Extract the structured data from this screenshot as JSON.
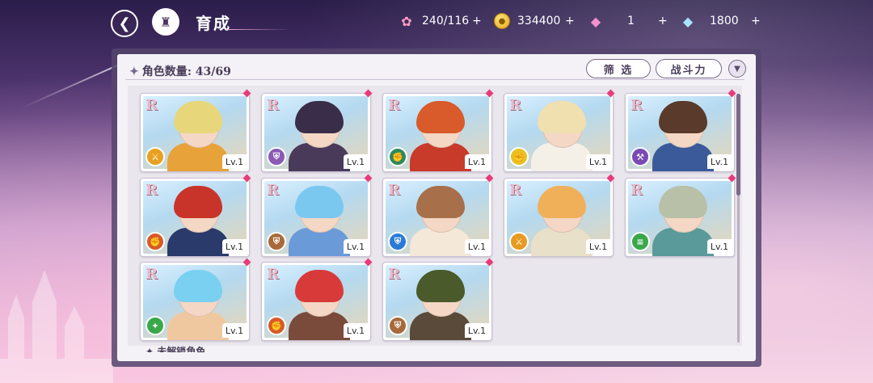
{
  "header": {
    "title": "育成",
    "resources": [
      {
        "icon": "candy-icon",
        "value": "240/116"
      },
      {
        "icon": "coin-icon",
        "value": "334400"
      },
      {
        "icon": "pink-gem-icon",
        "value": "1"
      },
      {
        "icon": "blue-gem-icon",
        "value": "1800"
      }
    ]
  },
  "panel": {
    "count_label": "角色数量: 43/69",
    "filter_label": "筛 选",
    "sort_label": "战斗力",
    "footer_label": "未解锁角色"
  },
  "characters": [
    {
      "rarity": "R",
      "level": "Lv.1",
      "hair": "#e8d77a",
      "outfit": "#e8a23a",
      "role_color": "#e8a020",
      "role_icon": "dagger-icon"
    },
    {
      "rarity": "R",
      "level": "Lv.1",
      "hair": "#3a2d4a",
      "outfit": "#4a3a5a",
      "role_color": "#8a5ab5",
      "role_icon": "shield-icon"
    },
    {
      "rarity": "R",
      "level": "Lv.1",
      "hair": "#d95a2a",
      "outfit": "#c83a2a",
      "role_color": "#2e8a5a",
      "role_icon": "fist-icon"
    },
    {
      "rarity": "R",
      "level": "Lv.1",
      "hair": "#f0e0b0",
      "outfit": "#f4f0e8",
      "role_color": "#e8c020",
      "role_icon": "fist-icon"
    },
    {
      "rarity": "R",
      "level": "Lv.1",
      "hair": "#5a3a2a",
      "outfit": "#3a5a9a",
      "role_color": "#7a4ab5",
      "role_icon": "hammer-icon"
    },
    {
      "rarity": "R",
      "level": "Lv.1",
      "hair": "#c8342a",
      "outfit": "#2a3a6a",
      "role_color": "#d85a2a",
      "role_icon": "fist-icon"
    },
    {
      "rarity": "R",
      "level": "Lv.1",
      "hair": "#7ac8f0",
      "outfit": "#6a9ad8",
      "role_color": "#a86a3a",
      "role_icon": "shield-icon"
    },
    {
      "rarity": "R",
      "level": "Lv.1",
      "hair": "#a8704a",
      "outfit": "#f4e8d8",
      "role_color": "#2a7ad8",
      "role_icon": "shield-icon"
    },
    {
      "rarity": "R",
      "level": "Lv.1",
      "hair": "#f0b05a",
      "outfit": "#e8e0c8",
      "role_color": "#e89a20",
      "role_icon": "dagger-icon"
    },
    {
      "rarity": "R",
      "level": "Lv.1",
      "hair": "#b8c0a8",
      "outfit": "#5a9a9a",
      "role_color": "#3aa84a",
      "role_icon": "book-icon"
    },
    {
      "rarity": "R",
      "level": "Lv.1",
      "hair": "#7ad0f0",
      "outfit": "#f0c8a0",
      "role_color": "#3aa84a",
      "role_icon": "wand-icon"
    },
    {
      "rarity": "R",
      "level": "Lv.1",
      "hair": "#d83a3a",
      "outfit": "#7a4a3a",
      "role_color": "#d85a2a",
      "role_icon": "fist-icon"
    },
    {
      "rarity": "R",
      "level": "Lv.1",
      "hair": "#4a5a2a",
      "outfit": "#5a4a3a",
      "role_color": "#a86a3a",
      "role_icon": "shield-icon"
    }
  ]
}
